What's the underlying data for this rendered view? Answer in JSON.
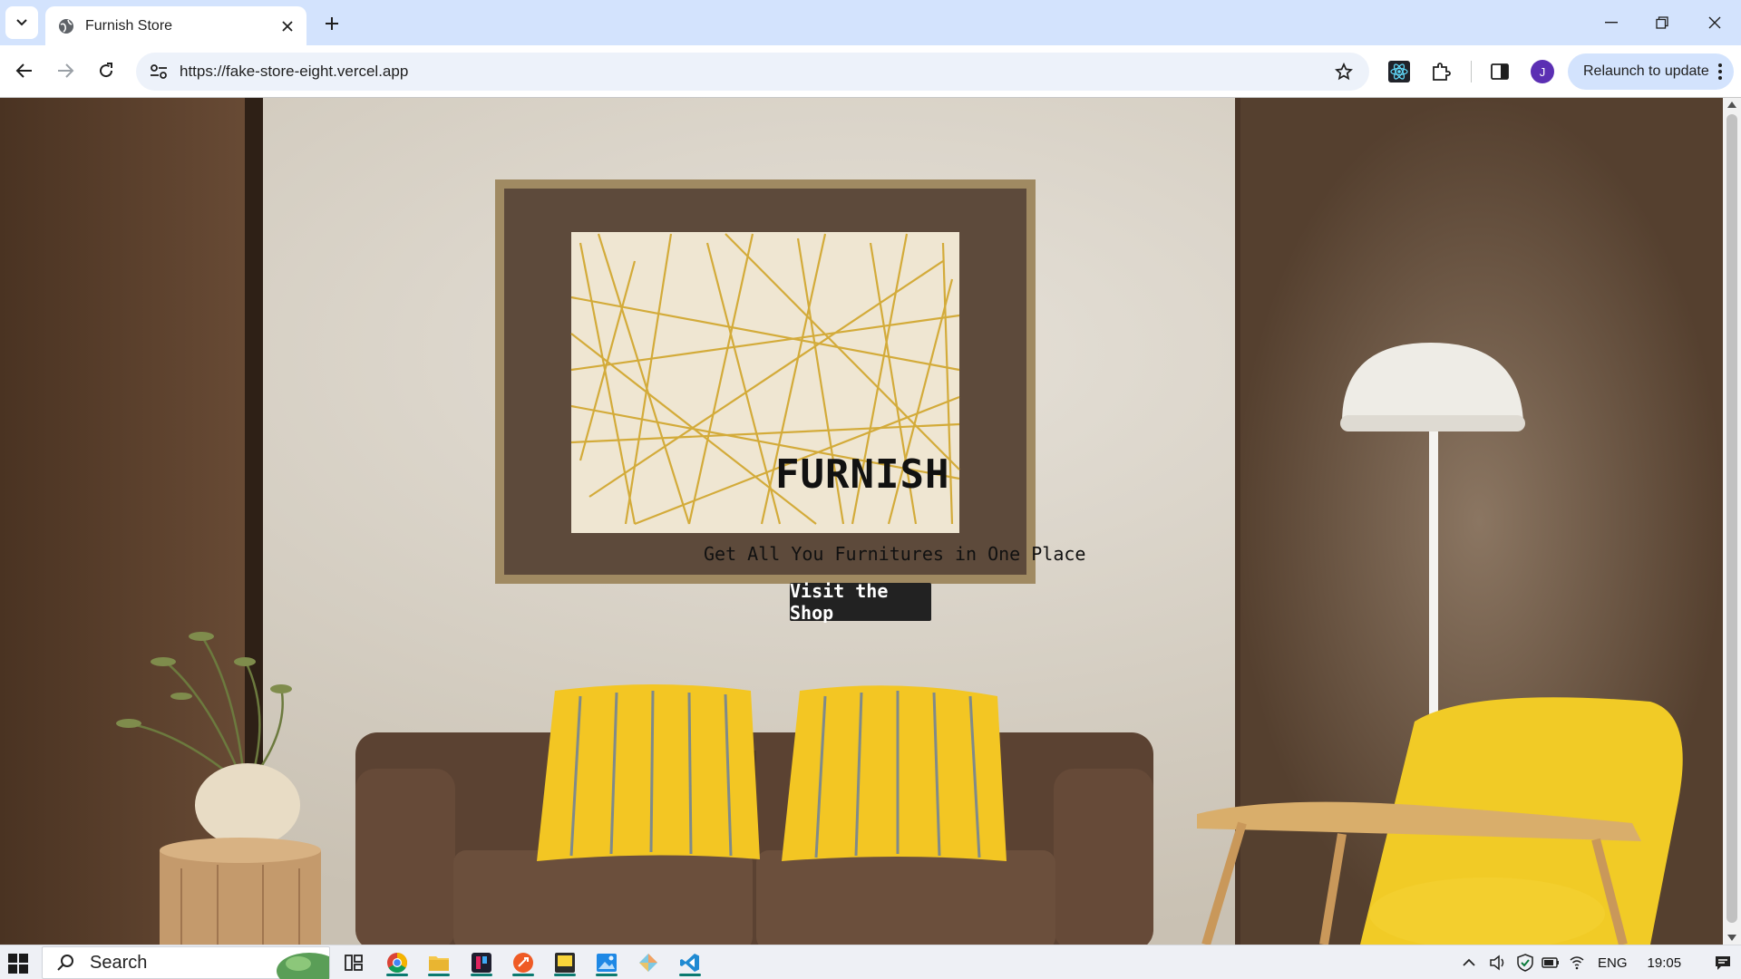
{
  "browser": {
    "tab_title": "Furnish Store",
    "url": "https://fake-store-eight.vercel.app",
    "avatar_letter": "J",
    "relaunch_label": "Relaunch to update"
  },
  "hero": {
    "title": "FURNISH",
    "subtitle": "Get All You Furnitures in One Place",
    "button_label": "Visit the Shop"
  },
  "taskbar": {
    "search_label": "Search",
    "language": "ENG",
    "time": "19:05",
    "apps": [
      "chrome-icon",
      "file-explorer-icon",
      "app-icon-dark",
      "postman-icon",
      "sticky-notes-icon",
      "photos-icon",
      "app-icon-diamond",
      "vscode-icon"
    ]
  },
  "colors": {
    "tab_strip": "#d3e3fd",
    "omnibox": "#edf2fa",
    "accent_yellow": "#f3c623",
    "sofa_brown": "#5b4232",
    "wall_brown": "#55402f"
  }
}
